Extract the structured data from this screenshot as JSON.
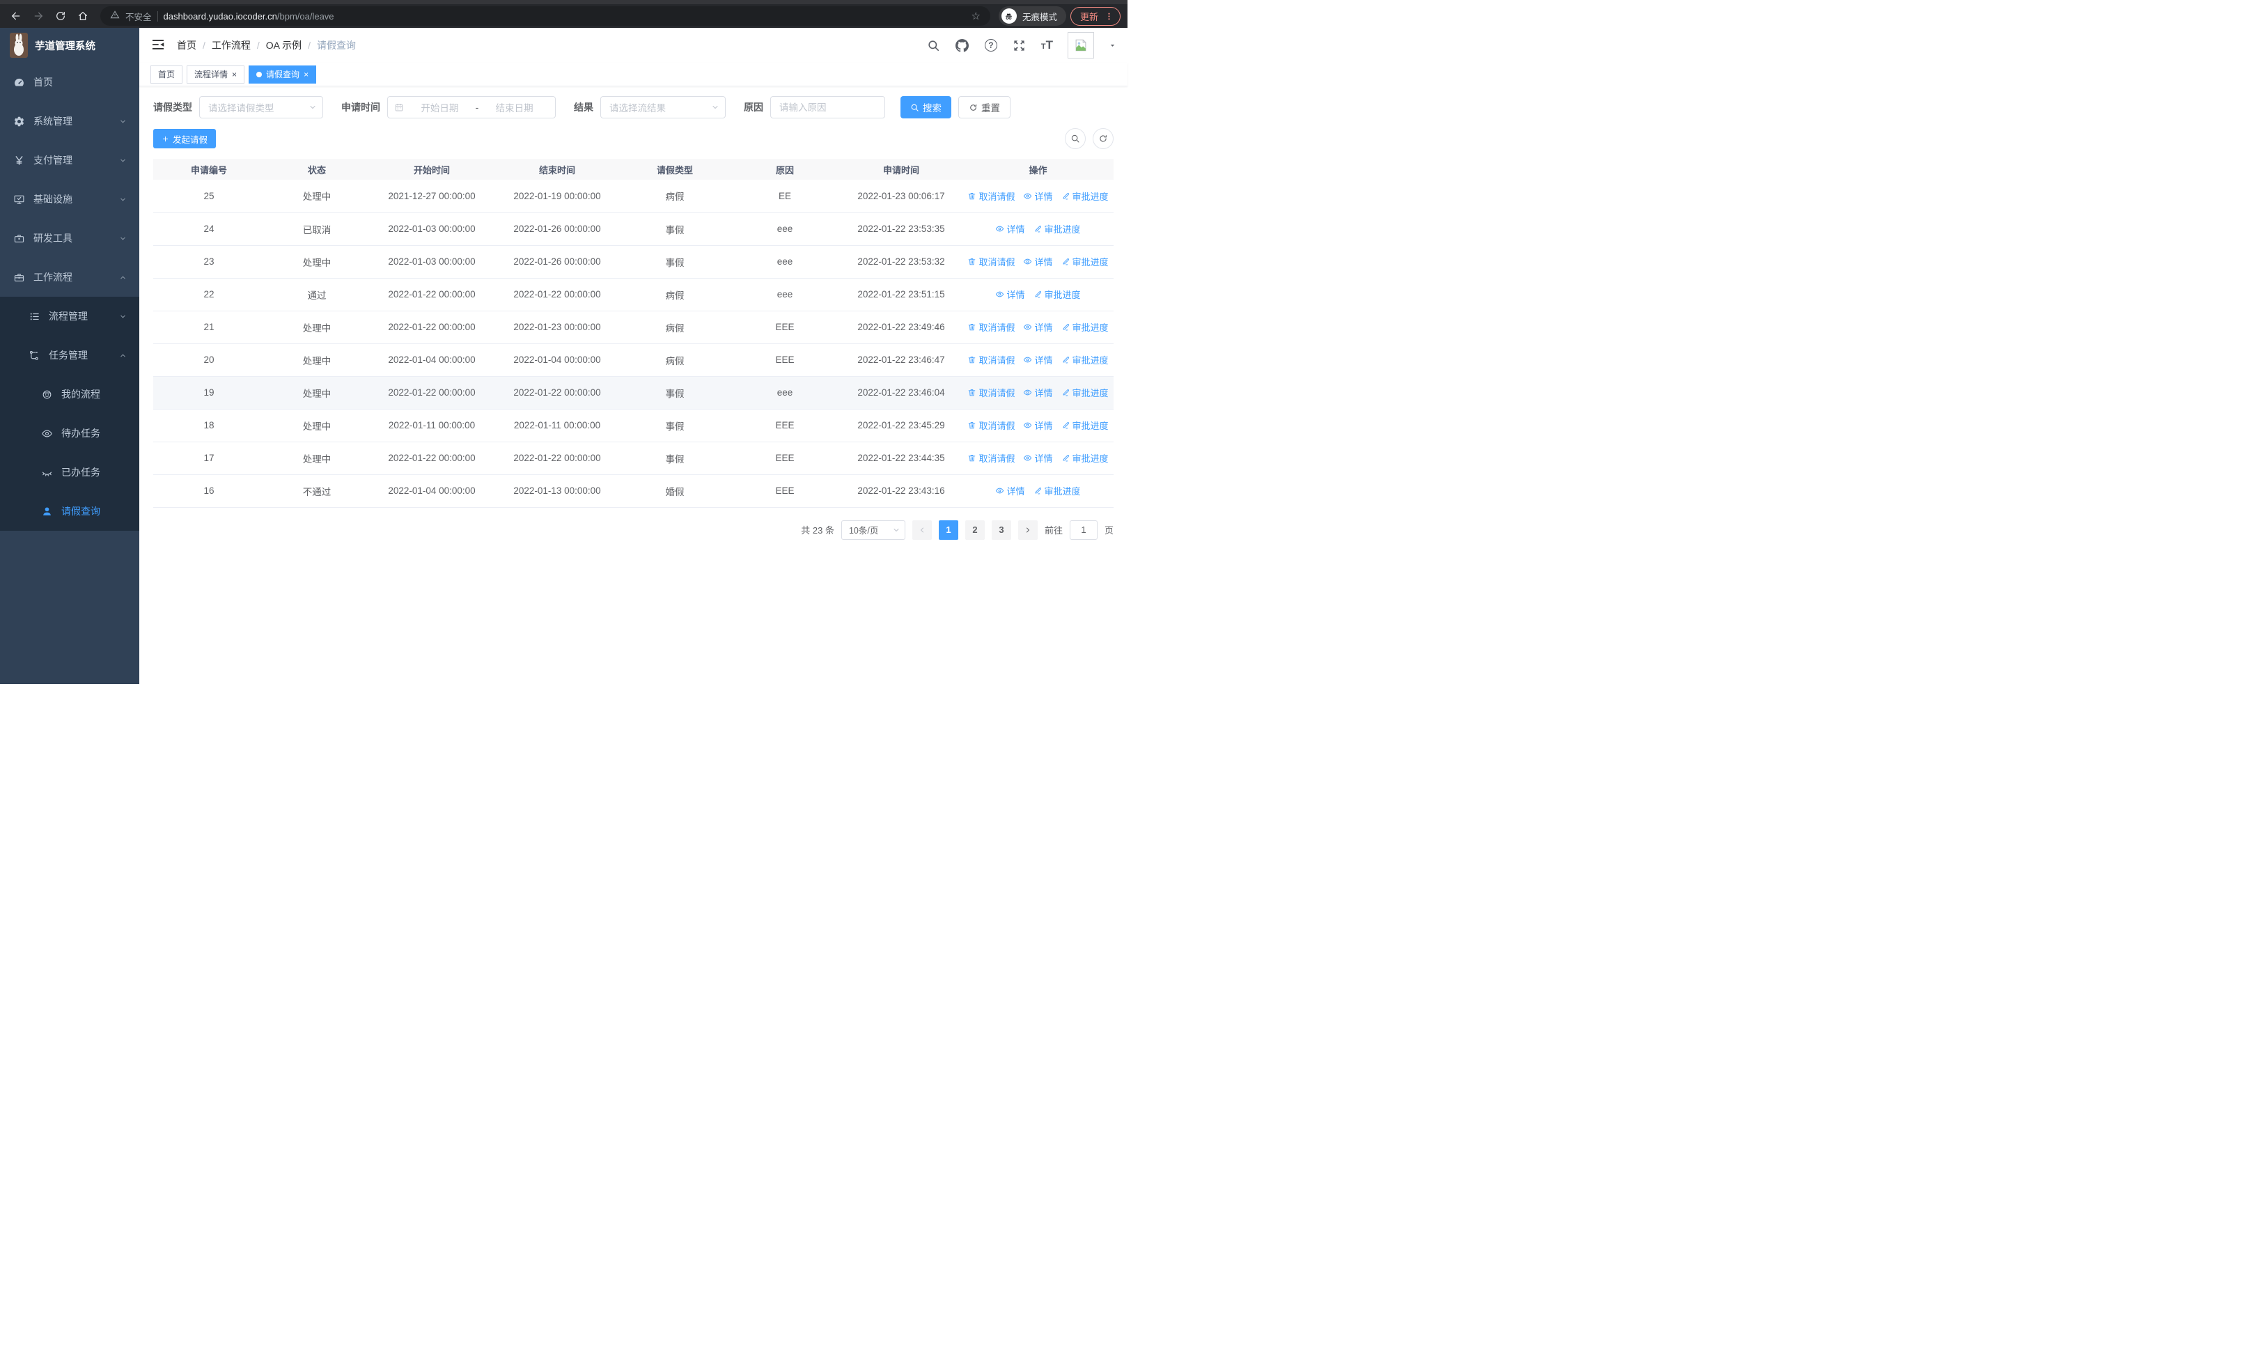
{
  "browser": {
    "security_label": "不安全",
    "url_host": "dashboard.yudao.iocoder.cn",
    "url_path": "/bpm/oa/leave",
    "incognito_label": "无痕模式",
    "update_label": "更新"
  },
  "sidebar": {
    "title": "芋道管理系统",
    "items": [
      {
        "label": "首页"
      },
      {
        "label": "系统管理"
      },
      {
        "label": "支付管理"
      },
      {
        "label": "基础设施"
      },
      {
        "label": "研发工具"
      },
      {
        "label": "工作流程"
      },
      {
        "label": "流程管理"
      },
      {
        "label": "任务管理"
      },
      {
        "label": "我的流程"
      },
      {
        "label": "待办任务"
      },
      {
        "label": "已办任务"
      },
      {
        "label": "请假查询"
      }
    ]
  },
  "header": {
    "breadcrumb": [
      {
        "label": "首页"
      },
      {
        "label": "工作流程"
      },
      {
        "label": "OA 示例"
      },
      {
        "label": "请假查询"
      }
    ]
  },
  "tabs": [
    {
      "label": "首页"
    },
    {
      "label": "流程详情"
    },
    {
      "label": "请假查询"
    }
  ],
  "filters": {
    "leave_type_label": "请假类型",
    "leave_type_placeholder": "请选择请假类型",
    "apply_time_label": "申请时间",
    "start_date_placeholder": "开始日期",
    "range_separator": "-",
    "end_date_placeholder": "结束日期",
    "result_label": "结果",
    "result_placeholder": "请选择流结果",
    "reason_label": "原因",
    "reason_placeholder": "请输入原因",
    "search_label": "搜索",
    "reset_label": "重置"
  },
  "toolbar": {
    "create_label": "发起请假"
  },
  "table": {
    "columns": [
      "申请编号",
      "状态",
      "开始时间",
      "结束时间",
      "请假类型",
      "原因",
      "申请时间",
      "操作"
    ],
    "action_labels": {
      "cancel": "取消请假",
      "detail": "详情",
      "progress": "审批进度"
    },
    "rows": [
      {
        "id": "25",
        "status": "处理中",
        "start": "2021-12-27 00:00:00",
        "end": "2022-01-19 00:00:00",
        "type": "病假",
        "reason": "EE",
        "apply": "2022-01-23 00:06:17",
        "actions": [
          "cancel",
          "detail",
          "progress"
        ]
      },
      {
        "id": "24",
        "status": "已取消",
        "start": "2022-01-03 00:00:00",
        "end": "2022-01-26 00:00:00",
        "type": "事假",
        "reason": "eee",
        "apply": "2022-01-22 23:53:35",
        "actions": [
          "detail",
          "progress"
        ]
      },
      {
        "id": "23",
        "status": "处理中",
        "start": "2022-01-03 00:00:00",
        "end": "2022-01-26 00:00:00",
        "type": "事假",
        "reason": "eee",
        "apply": "2022-01-22 23:53:32",
        "actions": [
          "cancel",
          "detail",
          "progress"
        ]
      },
      {
        "id": "22",
        "status": "通过",
        "start": "2022-01-22 00:00:00",
        "end": "2022-01-22 00:00:00",
        "type": "病假",
        "reason": "eee",
        "apply": "2022-01-22 23:51:15",
        "actions": [
          "detail",
          "progress"
        ]
      },
      {
        "id": "21",
        "status": "处理中",
        "start": "2022-01-22 00:00:00",
        "end": "2022-01-23 00:00:00",
        "type": "病假",
        "reason": "EEE",
        "apply": "2022-01-22 23:49:46",
        "actions": [
          "cancel",
          "detail",
          "progress"
        ]
      },
      {
        "id": "20",
        "status": "处理中",
        "start": "2022-01-04 00:00:00",
        "end": "2022-01-04 00:00:00",
        "type": "病假",
        "reason": "EEE",
        "apply": "2022-01-22 23:46:47",
        "actions": [
          "cancel",
          "detail",
          "progress"
        ]
      },
      {
        "id": "19",
        "status": "处理中",
        "start": "2022-01-22 00:00:00",
        "end": "2022-01-22 00:00:00",
        "type": "事假",
        "reason": "eee",
        "apply": "2022-01-22 23:46:04",
        "actions": [
          "cancel",
          "detail",
          "progress"
        ],
        "highlighted": true
      },
      {
        "id": "18",
        "status": "处理中",
        "start": "2022-01-11 00:00:00",
        "end": "2022-01-11 00:00:00",
        "type": "事假",
        "reason": "EEE",
        "apply": "2022-01-22 23:45:29",
        "actions": [
          "cancel",
          "detail",
          "progress"
        ]
      },
      {
        "id": "17",
        "status": "处理中",
        "start": "2022-01-22 00:00:00",
        "end": "2022-01-22 00:00:00",
        "type": "事假",
        "reason": "EEE",
        "apply": "2022-01-22 23:44:35",
        "actions": [
          "cancel",
          "detail",
          "progress"
        ]
      },
      {
        "id": "16",
        "status": "不通过",
        "start": "2022-01-04 00:00:00",
        "end": "2022-01-13 00:00:00",
        "type": "婚假",
        "reason": "EEE",
        "apply": "2022-01-22 23:43:16",
        "actions": [
          "detail",
          "progress"
        ]
      }
    ]
  },
  "pagination": {
    "total": "共 23 条",
    "page_size": "10条/页",
    "pages": [
      "1",
      "2",
      "3"
    ],
    "active_page": "1",
    "goto_label": "前往",
    "goto_value": "1",
    "page_label": "页"
  },
  "colors": {
    "primary": "#409eff",
    "sidebar_bg": "#304156",
    "submenu_bg": "#1f2d3d",
    "update_accent": "#f28b82",
    "table_header_bg": "#f8f8f9"
  }
}
